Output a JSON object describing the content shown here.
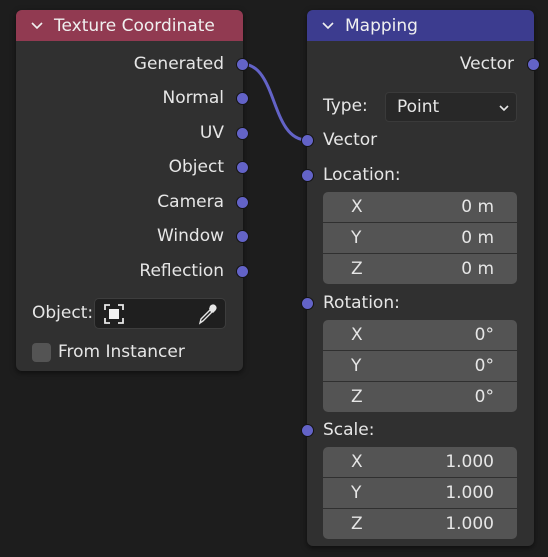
{
  "texture_node": {
    "title": "Texture Coordinate",
    "header_color": "#913a51",
    "outputs": [
      "Generated",
      "Normal",
      "UV",
      "Object",
      "Camera",
      "Window",
      "Reflection"
    ],
    "object_label": "Object:",
    "from_instancer_label": "From Instancer",
    "from_instancer_checked": false
  },
  "mapping_node": {
    "title": "Mapping",
    "header_color": "#3c3c8f",
    "output_label": "Vector",
    "type_label": "Type:",
    "type_value": "Point",
    "vector_input_label": "Vector",
    "location": {
      "label": "Location:",
      "x": "0 m",
      "y": "0 m",
      "z": "0 m"
    },
    "rotation": {
      "label": "Rotation:",
      "x": "0°",
      "y": "0°",
      "z": "0°"
    },
    "scale": {
      "label": "Scale:",
      "x": "1.000",
      "y": "1.000",
      "z": "1.000"
    },
    "axis_labels": {
      "x": "X",
      "y": "Y",
      "z": "Z"
    }
  },
  "socket_color": "#6363c7",
  "link_color": "#6363c7",
  "icons": [
    "chevron-down-icon",
    "object-target-icon",
    "eyedropper-icon",
    "dropdown-chevron-icon"
  ]
}
